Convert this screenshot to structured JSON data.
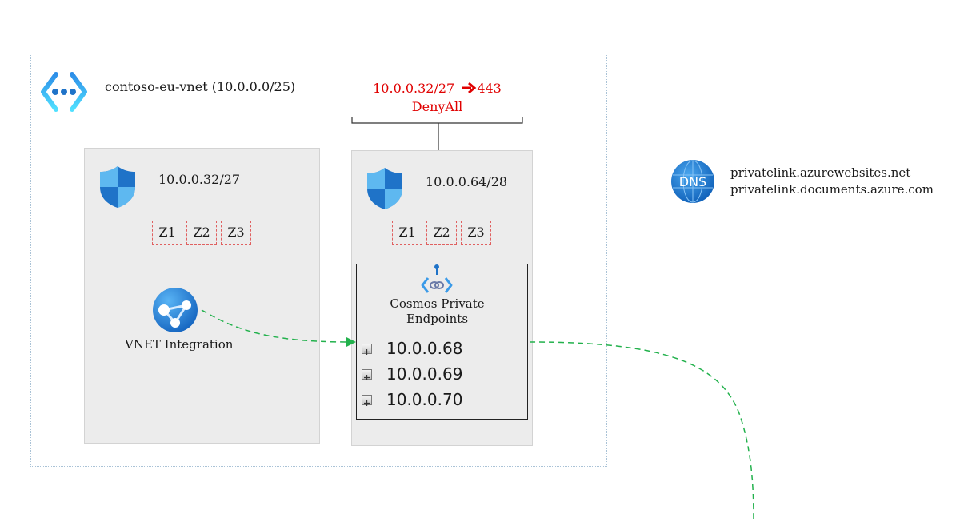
{
  "vnet": {
    "title": "contoso-eu-vnet (10.0.0.0/25)",
    "icon": "virtual-network-icon"
  },
  "nsg_rule": {
    "line1_source": "10.0.0.32/27",
    "line1_port": "443",
    "line2": "DenyAll",
    "color": "#e00000"
  },
  "subnet_left": {
    "cidr": "10.0.0.32/27",
    "icon": "shield-icon",
    "zones": [
      "Z1",
      "Z2",
      "Z3"
    ],
    "app": {
      "label": "VNET Integration",
      "icon": "app-service-icon"
    }
  },
  "subnet_right": {
    "cidr": "10.0.0.64/28",
    "icon": "shield-icon",
    "zones": [
      "Z1",
      "Z2",
      "Z3"
    ],
    "private_endpoints": {
      "label_line1": "Cosmos Private",
      "label_line2": "Endpoints",
      "icon": "private-endpoint-icon",
      "ips": [
        "10.0.0.68",
        "10.0.0.69",
        "10.0.0.70"
      ]
    }
  },
  "dns": {
    "badge": "DNS",
    "zones": [
      "privatelink.azurewebsites.net",
      "privatelink.documents.azure.com"
    ],
    "icon": "dns-icon"
  },
  "colors": {
    "connector": "#22b14c",
    "zone_border": "#e06060",
    "subnet_fill": "#ececec",
    "azure_blue": "#1f73c8"
  }
}
